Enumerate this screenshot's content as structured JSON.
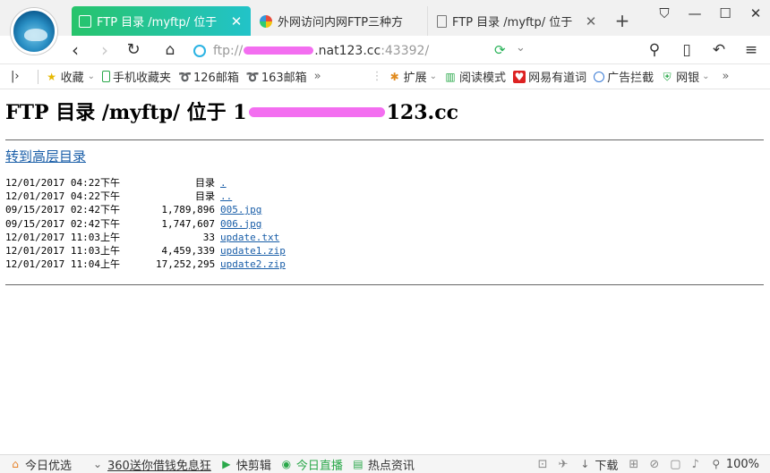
{
  "tabs": [
    {
      "title": "FTP 目录 /myftp/ 位于",
      "active": true
    },
    {
      "title": "外网访问内网FTP三种方",
      "active": false
    },
    {
      "title": "FTP 目录 /myftp/ 位于",
      "active": false
    }
  ],
  "window_controls": {
    "skin": "⛉",
    "minimize": "—",
    "maximize": "☐",
    "close": "✕"
  },
  "address_bar": {
    "scheme": "ftp://",
    "host_visible": ".nat123.cc",
    "port": ":43392/"
  },
  "bookmarks": [
    {
      "label": "收藏",
      "icon": "star-icon"
    },
    {
      "label": "手机收藏夹",
      "icon": "phone-icon"
    },
    {
      "label": "126邮箱",
      "icon": "mail-icon"
    },
    {
      "label": "163邮箱",
      "icon": "mail-icon"
    },
    {
      "label": "扩展",
      "icon": "extension-icon"
    },
    {
      "label": "阅读模式",
      "icon": "read-icon"
    },
    {
      "label": "网易有道词",
      "icon": "dictionary-icon"
    },
    {
      "label": "广告拦截",
      "icon": "adblock-icon"
    },
    {
      "label": "网银",
      "icon": "bank-icon"
    }
  ],
  "page": {
    "title_prefix": "FTP 目录 /myftp/ 位于 1",
    "title_suffix": "123.cc",
    "up_link": "转到高层目录",
    "entries": [
      {
        "date": "12/01/2017 04:22下午",
        "size": "目录",
        "name": "."
      },
      {
        "date": "12/01/2017 04:22下午",
        "size": "目录",
        "name": ".."
      },
      {
        "date": "09/15/2017 02:42下午",
        "size": "1,789,896",
        "name": "005.jpg"
      },
      {
        "date": "09/15/2017 02:42下午",
        "size": "1,747,607",
        "name": "006.jpg"
      },
      {
        "date": "12/01/2017 11:03上午",
        "size": "33",
        "name": "update.txt"
      },
      {
        "date": "12/01/2017 11:03上午",
        "size": "4,459,339",
        "name": "update1.zip"
      },
      {
        "date": "12/01/2017 11:04上午",
        "size": "17,252,295",
        "name": "update2.zip"
      }
    ]
  },
  "status_bar": {
    "left": [
      {
        "label": "今日优选",
        "icon": "shop-icon"
      },
      {
        "label": "360送你借钱免息狂",
        "icon": "chevron-down-icon"
      },
      {
        "label": "快剪辑",
        "icon": "video-icon"
      },
      {
        "label": "今日直播",
        "icon": "live-icon"
      },
      {
        "label": "热点资讯",
        "icon": "news-icon"
      }
    ],
    "download": "下载",
    "zoom": "100%"
  }
}
